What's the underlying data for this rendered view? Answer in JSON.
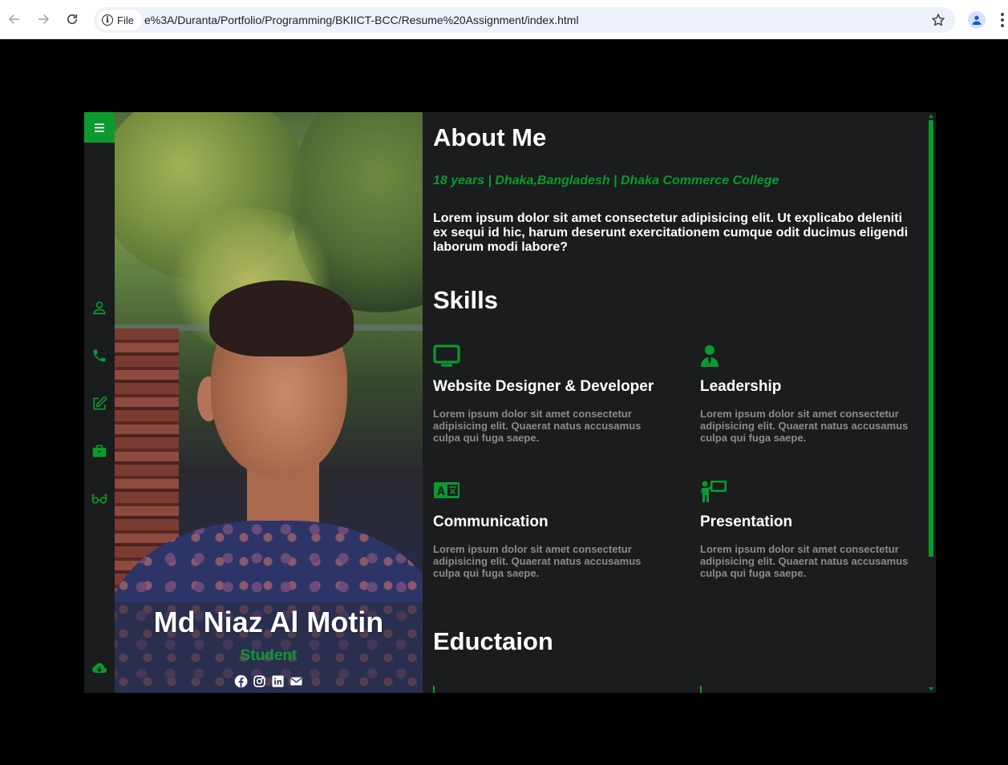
{
  "browser": {
    "chip_label": "File",
    "url": "e%3A/Duranta/Portfolio/Programming/BKIICT-BCC/Resume%20Assignment/index.html"
  },
  "profile": {
    "name": "Md Niaz Al Motin",
    "role": "Student",
    "socials": [
      "facebook-icon",
      "instagram-icon",
      "linkedin-icon",
      "envelope-icon"
    ]
  },
  "sidebar": {
    "icons": [
      "user-icon",
      "phone-icon",
      "edit-icon",
      "briefcase-icon",
      "glasses-icon",
      "cloud-download-icon"
    ]
  },
  "about": {
    "heading": "About Me",
    "meta": "18 years | Dhaka,Bangladesh | Dhaka Commerce College",
    "intro": "Lorem ipsum dolor sit amet consectetur adipisicing elit. Ut explicabo deleniti ex sequi id hic, harum deserunt exercitationem cumque odit ducimus eligendi laborum modi labore?"
  },
  "skills": {
    "heading": "Skills",
    "items": [
      {
        "icon": "monitor-icon",
        "title": "Website Designer & Developer",
        "desc": "Lorem ipsum dolor sit amet consectetur adipisicing elit. Quaerat natus accusamus culpa qui fuga saepe."
      },
      {
        "icon": "user-tie-icon",
        "title": "Leadership",
        "desc": "Lorem ipsum dolor sit amet consectetur adipisicing elit. Quaerat natus accusamus culpa qui fuga saepe."
      },
      {
        "icon": "language-icon",
        "title": "Communication",
        "desc": "Lorem ipsum dolor sit amet consectetur adipisicing elit. Quaerat natus accusamus culpa qui fuga saepe."
      },
      {
        "icon": "presentation-icon",
        "title": "Presentation",
        "desc": "Lorem ipsum dolor sit amet consectetur adipisicing elit. Quaerat natus accusamus culpa qui fuga saepe."
      }
    ]
  },
  "education": {
    "heading": "Eductaion"
  },
  "colors": {
    "accent": "#0a9a2e",
    "panel": "#1b1c1e",
    "background": "#000000"
  }
}
